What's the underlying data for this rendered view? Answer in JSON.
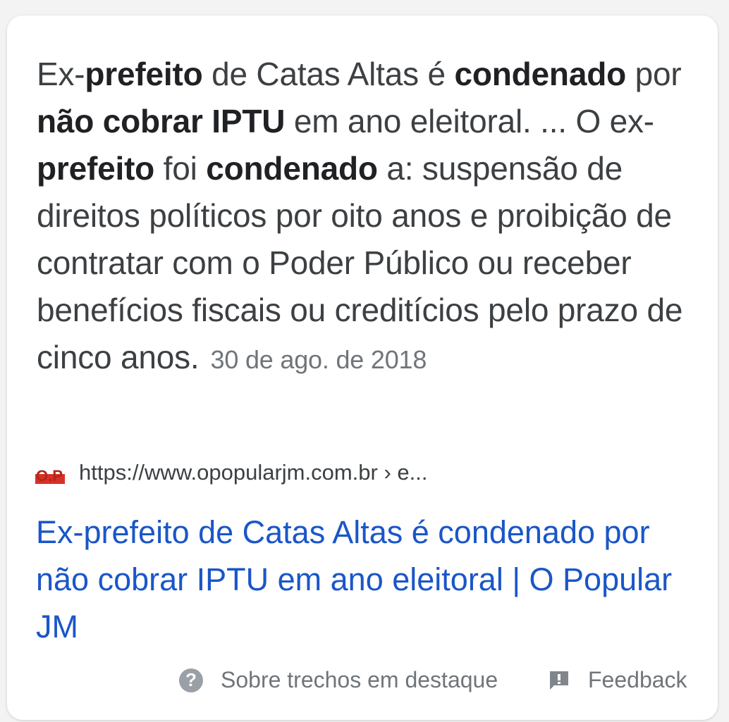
{
  "snippet": {
    "s1": "Ex-",
    "b1": "prefeito",
    "s2": " de Catas Altas é ",
    "b2": "condenado",
    "s3": " por ",
    "b3": "não cobrar IPTU",
    "s4": " em ano eleitoral. ... O ex-",
    "b4": "prefeito",
    "s5": " foi ",
    "b5": "condenado",
    "s6": " a: suspensão de direitos políticos por oito anos e proibição de contratar com o Poder Público ou receber benefícios fiscais ou creditícios pelo prazo de cinco anos.",
    "date": "30 de ago. de 2018"
  },
  "source": {
    "favicon_text": "O.P",
    "url": "https://www.opopularjm.com.br › e..."
  },
  "result": {
    "title": "Ex-prefeito de Catas Altas é condenado por não cobrar IPTU em ano eleitoral | O Popular JM"
  },
  "footer": {
    "about_label": "Sobre trechos em destaque",
    "feedback_label": "Feedback"
  },
  "colors": {
    "link": "#1a56c8",
    "text": "#3c4043",
    "muted": "#70757a",
    "favicon_red": "#d93025"
  }
}
